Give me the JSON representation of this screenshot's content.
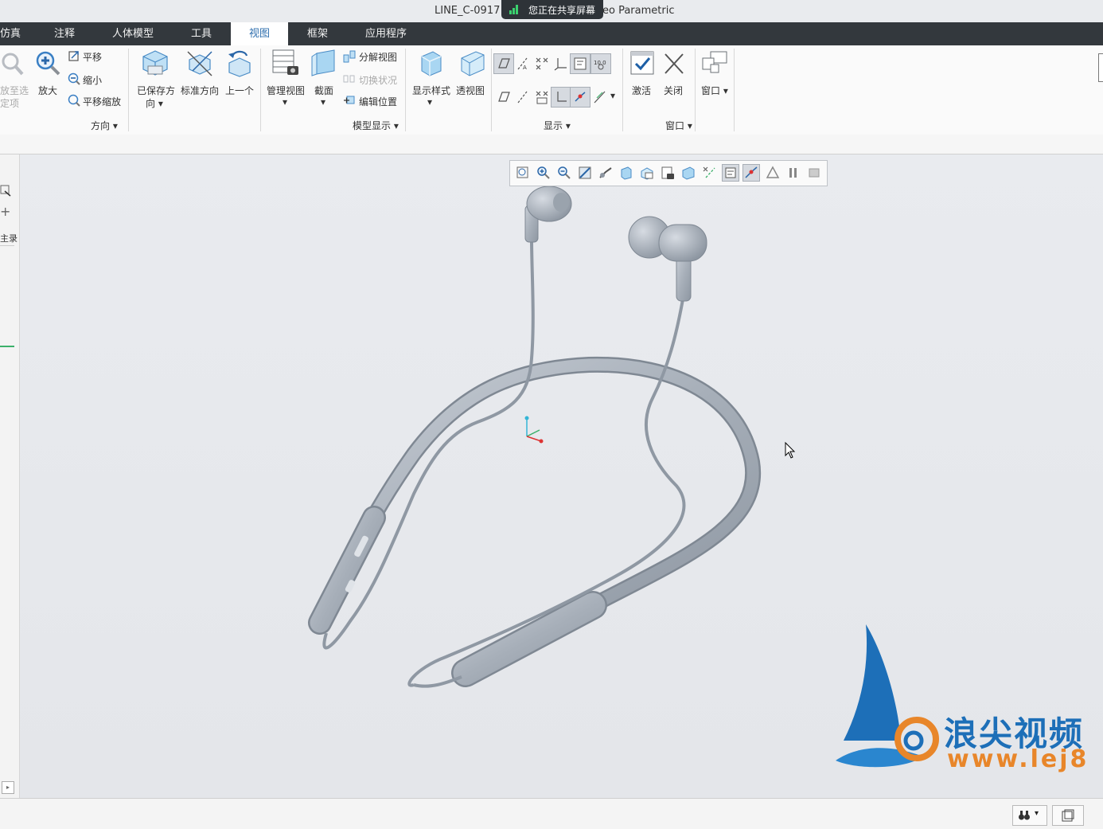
{
  "window": {
    "title_left": "LINE_C-0917",
    "title_right": "eo Parametric",
    "share_notice": "您正在共享屏幕"
  },
  "tabs": [
    {
      "label": "仿真"
    },
    {
      "label": "注释"
    },
    {
      "label": "人体模型"
    },
    {
      "label": "工具"
    },
    {
      "label": "视图",
      "active": true
    },
    {
      "label": "框架"
    },
    {
      "label": "应用程序"
    }
  ],
  "ribbon": {
    "orientation": {
      "zoom_fit_line1": "放至选",
      "zoom_fit_line2": "定项",
      "zoom_in": "放大",
      "pan": "平移",
      "zoom_out": "缩小",
      "pan_zoom": "平移缩放",
      "saved_orient_line1": "已保存方",
      "saved_orient_line2": "向",
      "standard_orient": "标准方向",
      "previous": "上一个",
      "group_label": "方向"
    },
    "model_display": {
      "manage_views": "管理视图",
      "section": "截面",
      "explode_view": "分解视图",
      "toggle_status": "切换状况",
      "edit_position": "编辑位置",
      "display_style": "显示样式",
      "perspective": "透视图",
      "group_label": "模型显示"
    },
    "show": {
      "group_label": "显示"
    },
    "window": {
      "activate": "激活",
      "close": "关闭",
      "windows": "窗口",
      "group_label": "窗口"
    }
  },
  "left_panel": {
    "label": "主录"
  },
  "watermark": {
    "cn_text": "浪尖视频",
    "url_text": "www.lej8"
  },
  "colors": {
    "tabbar": "#33383d",
    "active_tab_text": "#2f6fae",
    "model": "#a9b1bb",
    "watermark_blue": "#1d6fb8",
    "watermark_orange": "#e8862a",
    "share_green": "#3bd16f"
  }
}
